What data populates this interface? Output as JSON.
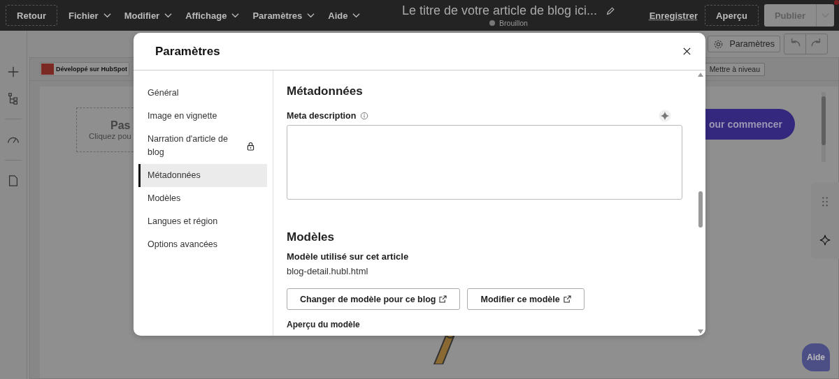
{
  "top_bar": {
    "back_button": "Retour",
    "menus": [
      {
        "label": "Fichier"
      },
      {
        "label": "Modifier"
      },
      {
        "label": "Affichage"
      },
      {
        "label": "Paramètres"
      },
      {
        "label": "Aide"
      }
    ],
    "title": "Le titre de votre article de blog ici...",
    "status": "Brouillon",
    "save_link": "Enregistrer",
    "preview_button": "Aperçu",
    "publish_button": "Publier"
  },
  "toolbar": {
    "settings_button": "Paramètres"
  },
  "editor": {
    "badge": "Développé sur HubSpot",
    "upgrade_button": "Mettre à niveau",
    "placeholder_title": "Pas",
    "placeholder_text": "Cliquez pou",
    "cta_button": "our commencer"
  },
  "help_button": "Aide",
  "modal": {
    "title": "Paramètres",
    "nav": [
      {
        "label": "Général",
        "selected": false,
        "locked": false
      },
      {
        "label": "Image en vignette",
        "selected": false,
        "locked": false
      },
      {
        "label": "Narration d'article de blog",
        "selected": false,
        "locked": true
      },
      {
        "label": "Métadonnées",
        "selected": true,
        "locked": false
      },
      {
        "label": "Modèles",
        "selected": false,
        "locked": false
      },
      {
        "label": "Langues et région",
        "selected": false,
        "locked": false
      },
      {
        "label": "Options avancées",
        "selected": false,
        "locked": false
      }
    ],
    "metadata": {
      "title": "Métadonnées",
      "field_label": "Meta description"
    },
    "templates": {
      "title": "Modèles",
      "used_label": "Modèle utilisé sur cet article",
      "template_file": "blog-detail.hubl.html",
      "buttons": [
        "Changer de modèle pour ce blog",
        "Modifier ce modèle"
      ],
      "preview_label": "Aperçu du modèle"
    }
  }
}
